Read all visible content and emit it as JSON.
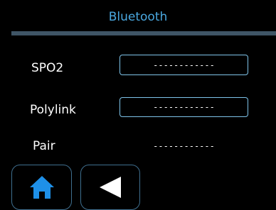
{
  "header": {
    "title": "Bluetooth"
  },
  "rows": [
    {
      "label": "SPO2",
      "value": "------------"
    },
    {
      "label": "Polylink",
      "value": "------------"
    },
    {
      "label": "Pair",
      "value": "------------"
    }
  ],
  "nav": {
    "home_icon": "home-icon",
    "back_icon": "back-triangle-icon"
  },
  "colors": {
    "title": "#4aa8e0",
    "accent_bar": "#3f5566",
    "field_border": "#7fc4ea",
    "home_icon": "#1e90e8",
    "nav_border": "#3f6f8f"
  }
}
